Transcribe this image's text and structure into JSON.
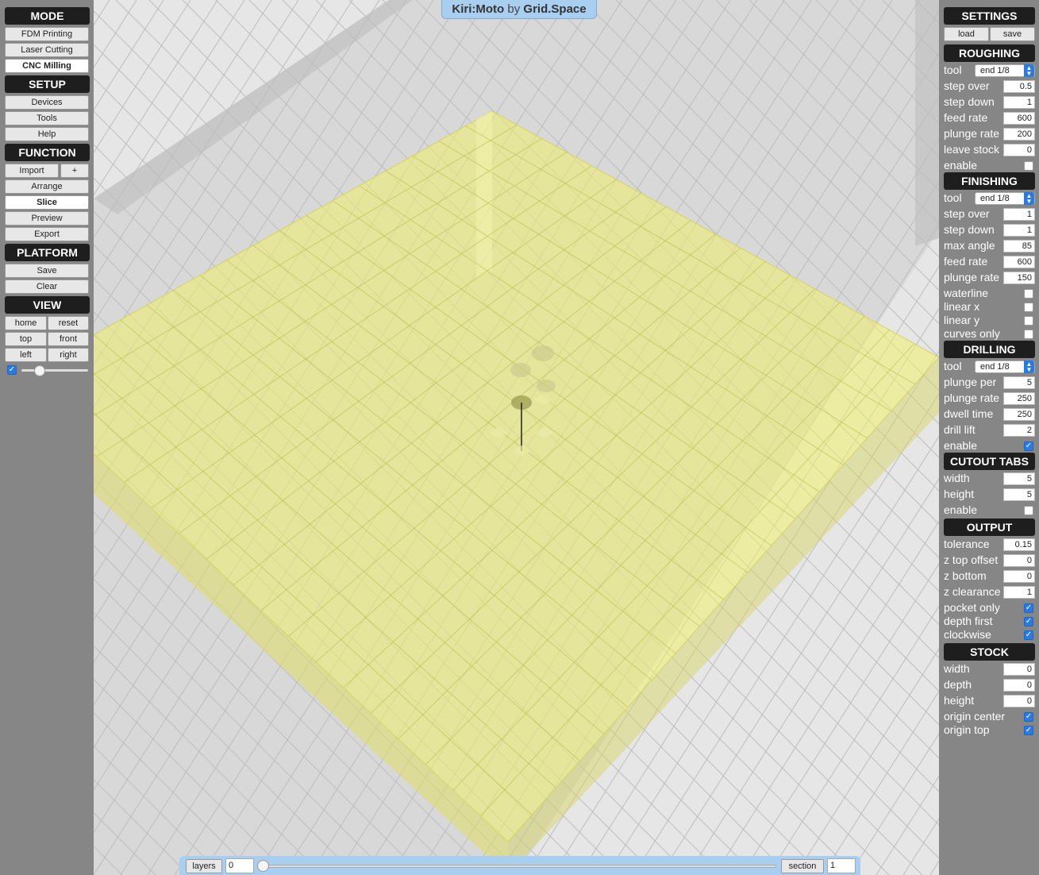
{
  "title": {
    "brand": "Kiri:Moto",
    "by": "by",
    "company": "Grid.Space"
  },
  "left": {
    "mode": {
      "header": "MODE",
      "items": [
        "FDM Printing",
        "Laser Cutting",
        "CNC Milling"
      ],
      "active": "CNC Milling"
    },
    "setup": {
      "header": "SETUP",
      "items": [
        "Devices",
        "Tools",
        "Help"
      ]
    },
    "function": {
      "header": "FUNCTION",
      "import": "Import",
      "plus": "+",
      "items": [
        "Arrange",
        "Slice",
        "Preview",
        "Export"
      ],
      "active": "Slice"
    },
    "platform": {
      "header": "PLATFORM",
      "items": [
        "Save",
        "Clear"
      ]
    },
    "view": {
      "header": "VIEW",
      "buttons": [
        "home",
        "reset",
        "top",
        "front",
        "left",
        "right"
      ],
      "slider_checked": true
    }
  },
  "right": {
    "settings": {
      "header": "SETTINGS",
      "load": "load",
      "save": "save"
    },
    "roughing": {
      "header": "ROUGHING",
      "tool": {
        "label": "tool",
        "value": "end 1/8"
      },
      "fields": [
        {
          "label": "step over",
          "value": "0.5"
        },
        {
          "label": "step down",
          "value": "1"
        },
        {
          "label": "feed rate",
          "value": "600"
        },
        {
          "label": "plunge rate",
          "value": "200"
        },
        {
          "label": "leave stock",
          "value": "0"
        }
      ],
      "checks": [
        {
          "label": "enable",
          "checked": false
        }
      ]
    },
    "finishing": {
      "header": "FINISHING",
      "tool": {
        "label": "tool",
        "value": "end 1/8"
      },
      "fields": [
        {
          "label": "step over",
          "value": "1"
        },
        {
          "label": "step down",
          "value": "1"
        },
        {
          "label": "max angle",
          "value": "85"
        },
        {
          "label": "feed rate",
          "value": "600"
        },
        {
          "label": "plunge rate",
          "value": "150"
        }
      ],
      "checks": [
        {
          "label": "waterline",
          "checked": false
        },
        {
          "label": "linear x",
          "checked": false
        },
        {
          "label": "linear y",
          "checked": false
        },
        {
          "label": "curves only",
          "checked": false
        }
      ]
    },
    "drilling": {
      "header": "DRILLING",
      "tool": {
        "label": "tool",
        "value": "end 1/8"
      },
      "fields": [
        {
          "label": "plunge per",
          "value": "5"
        },
        {
          "label": "plunge rate",
          "value": "250"
        },
        {
          "label": "dwell time",
          "value": "250"
        },
        {
          "label": "drill lift",
          "value": "2"
        }
      ],
      "checks": [
        {
          "label": "enable",
          "checked": true
        }
      ]
    },
    "cutout": {
      "header": "CUTOUT TABS",
      "fields": [
        {
          "label": "width",
          "value": "5"
        },
        {
          "label": "height",
          "value": "5"
        }
      ],
      "checks": [
        {
          "label": "enable",
          "checked": false
        }
      ]
    },
    "output": {
      "header": "OUTPUT",
      "fields": [
        {
          "label": "tolerance",
          "value": "0.15"
        },
        {
          "label": "z top offset",
          "value": "0"
        },
        {
          "label": "z bottom",
          "value": "0"
        },
        {
          "label": "z clearance",
          "value": "1"
        }
      ],
      "checks": [
        {
          "label": "pocket only",
          "checked": true
        },
        {
          "label": "depth first",
          "checked": true
        },
        {
          "label": "clockwise",
          "checked": true
        }
      ]
    },
    "stock": {
      "header": "STOCK",
      "fields": [
        {
          "label": "width",
          "value": "0"
        },
        {
          "label": "depth",
          "value": "0"
        },
        {
          "label": "height",
          "value": "0"
        }
      ],
      "checks": [
        {
          "label": "origin center",
          "checked": true
        },
        {
          "label": "origin top",
          "checked": true
        }
      ]
    }
  },
  "bottom": {
    "layers_label": "layers",
    "layers_value": "0",
    "section_label": "section",
    "section_value": "1",
    "layer_fraction": 0
  },
  "colors": {
    "stock": "#f1f06a",
    "panel": "#868686",
    "header": "#1e1e1e",
    "accent": "#2a7ae2",
    "titlebar": "#a9cff0"
  }
}
